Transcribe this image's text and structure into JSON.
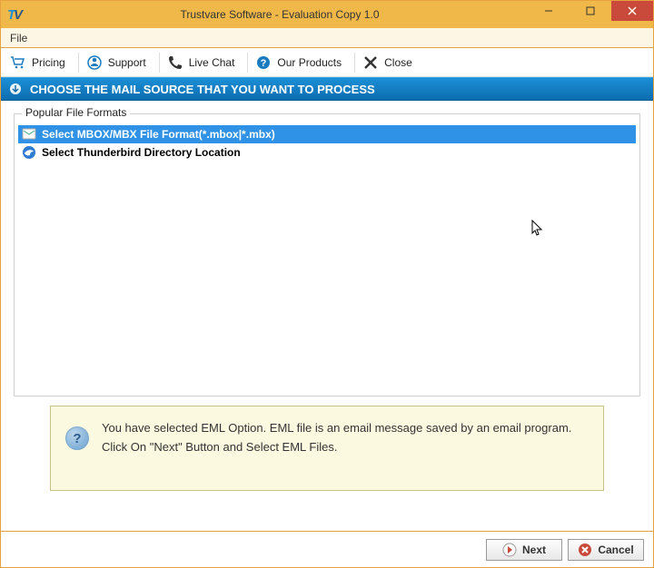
{
  "window": {
    "title": "Trustvare Software - Evaluation Copy 1.0"
  },
  "menubar": {
    "file": "File"
  },
  "toolbar": {
    "pricing": "Pricing",
    "support": "Support",
    "livechat": "Live Chat",
    "products": "Our Products",
    "close": "Close"
  },
  "header": {
    "text": "CHOOSE THE MAIL SOURCE THAT YOU WANT TO PROCESS"
  },
  "group": {
    "legend": "Popular File Formats",
    "items": [
      {
        "label": "Select MBOX/MBX File Format(*.mbox|*.mbx)",
        "selected": true
      },
      {
        "label": "Select Thunderbird Directory Location",
        "selected": false
      }
    ]
  },
  "info": {
    "text": "You have selected EML Option. EML file is an email message saved by an email program. Click On \"Next\" Button and Select EML Files."
  },
  "footer": {
    "next": "Next",
    "cancel": "Cancel"
  }
}
